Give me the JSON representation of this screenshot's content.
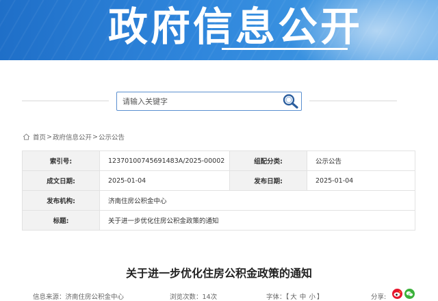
{
  "banner": {
    "title": "政府信息公开"
  },
  "search": {
    "placeholder": "请输入关键字"
  },
  "breadcrumb": {
    "items": [
      "首页",
      "政府信息公开",
      "公示公告"
    ],
    "separator": ">"
  },
  "info": {
    "index_label": "索引号:",
    "index_value": "12370100745691483A/2025-00002",
    "category_label": "组配分类:",
    "category_value": "公示公告",
    "created_label": "成文日期:",
    "created_value": "2025-01-04",
    "published_label": "发布日期:",
    "published_value": "2025-01-04",
    "agency_label": "发布机构:",
    "agency_value": "济南住房公积金中心",
    "subject_label": "标题:",
    "subject_value": "关于进一步优化住房公积金政策的通知"
  },
  "article": {
    "title": "关于进一步优化住房公积金政策的通知",
    "source": "信息来源：济南住房公积金中心",
    "views": "浏览次数：14次",
    "font_label": "字体：",
    "font_open": "【",
    "font_large": "大",
    "font_medium": "中",
    "font_small": "小",
    "font_close": "】",
    "share_label": "分享:"
  },
  "colors": {
    "banner": "#2f86dc",
    "weibo": "#e6162d",
    "wechat": "#3bb13a"
  },
  "icons": [
    "search-icon",
    "home-icon",
    "weibo-icon",
    "wechat-icon"
  ]
}
